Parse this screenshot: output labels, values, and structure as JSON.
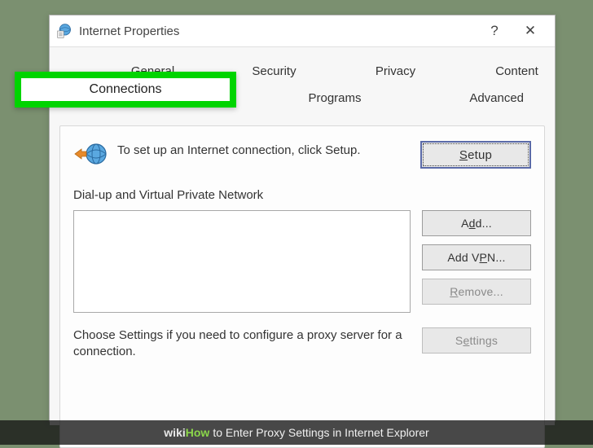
{
  "window": {
    "title": "Internet Properties",
    "help": "?",
    "close": "✕"
  },
  "tabs": {
    "row1": [
      "General",
      "Security",
      "Privacy",
      "Content"
    ],
    "row2": [
      "Connections",
      "Programs",
      "Advanced"
    ],
    "active": "Connections"
  },
  "main": {
    "setup_text": "To set up an Internet connection, click Setup.",
    "setup_button": "Setup",
    "dialup_label": "Dial-up and Virtual Private Network",
    "add_button": "Add...",
    "add_vpn_button": "Add VPN...",
    "remove_button": "Remove...",
    "settings_text": "Choose Settings if you need to configure a proxy server for a connection.",
    "settings_button": "Settings"
  },
  "caption": {
    "wiki_w": "wiki",
    "wiki_how": "How",
    "rest": " to Enter Proxy Settings in Internet Explorer"
  }
}
